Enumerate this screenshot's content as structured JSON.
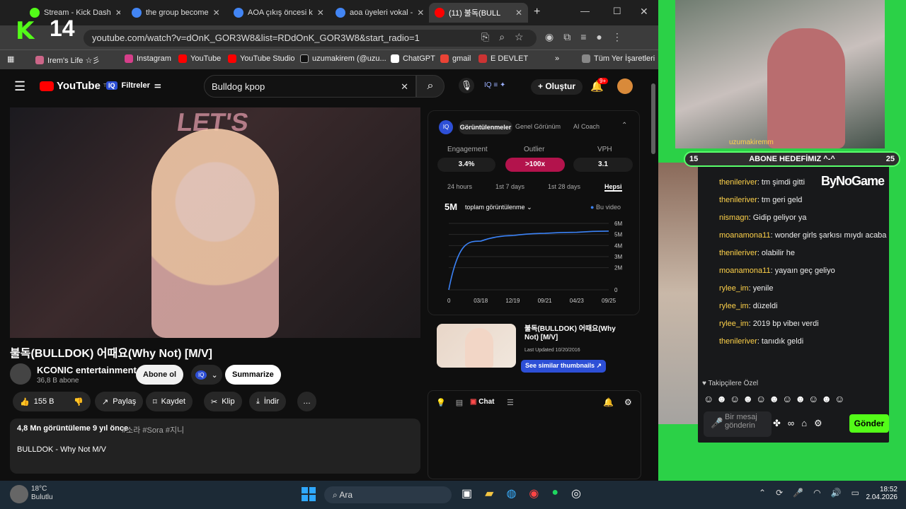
{
  "browser": {
    "tabs": [
      {
        "label": "Stream - Kick Dash",
        "color": "#53fc18"
      },
      {
        "label": "the group become",
        "color": "#4285f4"
      },
      {
        "label": "AOA çıkış öncesi k",
        "color": "#4285f4"
      },
      {
        "label": "aoa üyeleri vokal -",
        "color": "#4285f4"
      },
      {
        "label": "(11) 불독(BULL",
        "color": "#ff0000",
        "active": true
      }
    ],
    "url": "youtube.com/watch?v=dOnK_GOR3W8&list=RDdOnK_GOR3W8&start_radio=1",
    "bookmarks": [
      "Irem's Life ☆彡",
      "Instagram",
      "YouTube",
      "YouTube Studio",
      "uzumakirem (@uzu...",
      "ChatGPT",
      "gmail",
      "E DEVLET",
      "Tüm Yer İşaretleri"
    ],
    "stream_overlay": "14"
  },
  "youtube": {
    "logo": "YouTube",
    "logo_region": "TR",
    "filters_label": "Filtreler",
    "search_value": "Bulldog kpop",
    "create_label": "Oluştur",
    "notif_count": "9+",
    "video_title": "불독(BULLDOK) 어때요(Why Not) [M/V]",
    "channel": "KCONIC entertainment",
    "subscribers": "36,8 B abone",
    "subscribe_label": "Abone ol",
    "summarize_label": "Summarize",
    "likes": "155 B",
    "share": "Paylaş",
    "save": "Kaydet",
    "clip": "Klip",
    "download": "İndir",
    "views_time": "4,8 Mn görüntüleme  9 yıl önce",
    "hashtags": "#소라 #Sora #지니",
    "desc": "BULLDOK - Why Not M/V"
  },
  "analytics": {
    "tabs": [
      "Görüntülenmeler",
      "Genel Görünüm",
      "AI Coach"
    ],
    "metrics": [
      {
        "label": "Engagement",
        "value": "3.4%"
      },
      {
        "label": "Outlier",
        "value": ">100x"
      },
      {
        "label": "VPH",
        "value": "3.1"
      }
    ],
    "ranges": [
      "24 hours",
      "1st 7 days",
      "1st 28 days",
      "Hepsi"
    ],
    "total": "5M",
    "total_label": "toplam görüntülenme",
    "legend": "Bu video",
    "suggestion_title": "불독(BULLDOK) 어때요(Why Not) [M/V]",
    "suggestion_updated": "Last Updated 10/20/2016",
    "similar_btn": "See similar thumbnails",
    "chat_label": "Chat"
  },
  "chart_data": {
    "type": "line",
    "x": [
      "0",
      "03/18",
      "12/19",
      "09/21",
      "04/23",
      "09/25"
    ],
    "series": [
      {
        "name": "Bu video",
        "values": [
          0,
          4.4,
          4.9,
          5.1,
          5.2,
          5.3
        ]
      }
    ],
    "yticks": [
      "0",
      "2M",
      "3M",
      "4M",
      "5M",
      "6M"
    ],
    "ylim": [
      0,
      6
    ]
  },
  "stream": {
    "goal_left": "15",
    "goal_text": "ABONE HEDEFİMIZ ^-^",
    "goal_right": "25",
    "top_user": "uzumakiremm",
    "brand": "ByNoGame",
    "follower_label": "Takipçilere Özel",
    "send_label": "Gönder",
    "input_placeholder": "Bir mesaj gönderin",
    "messages": [
      {
        "user": "thenileriver",
        "text": "tm şimdi gitti"
      },
      {
        "user": "thenileriver",
        "text": "tm geri geld"
      },
      {
        "user": "nismagn",
        "text": "Gidip geliyor ya"
      },
      {
        "user": "moanamona11",
        "text": "wonder girls şarkısı mıydı acaba"
      },
      {
        "user": "thenileriver",
        "text": "olabilir he"
      },
      {
        "user": "moanamona11",
        "text": "yayaın geç geliyo"
      },
      {
        "user": "rylee_im",
        "text": "yenile"
      },
      {
        "user": "rylee_im",
        "text": "düzeldi"
      },
      {
        "user": "rylee_im",
        "text": "2019 bp vibeı verdi"
      },
      {
        "user": "thenileriver",
        "text": "tanıdık geldi"
      }
    ]
  },
  "taskbar": {
    "search": "Ara",
    "weather": "18°C Bulutlu",
    "time": "18:52",
    "date": "2.04.2026"
  }
}
